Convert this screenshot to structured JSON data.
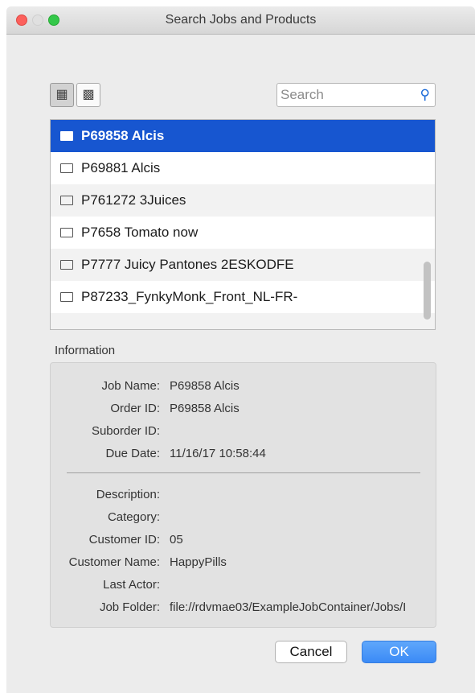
{
  "window": {
    "title": "Search Jobs and Products"
  },
  "toolbar": {
    "view_large_icon": "grid-large-icon",
    "view_small_icon": "grid-small-icon"
  },
  "search": {
    "placeholder": "Search",
    "icon": "magnifier-icon",
    "accent": "#1a6ad8"
  },
  "list": {
    "items": [
      {
        "label": "P69858 Alcis",
        "selected": true
      },
      {
        "label": "P69881 Alcis"
      },
      {
        "label": "P761272 3Juices"
      },
      {
        "label": "P7658 Tomato now"
      },
      {
        "label": "P7777 Juicy Pantones 2ESKODFE"
      },
      {
        "label": "P87233_FynkyMonk_Front_NL-FR-"
      }
    ],
    "selected_color": "#1756d0"
  },
  "information": {
    "title": "Information",
    "fields": [
      {
        "label": "Job Name:",
        "value": "P69858 Alcis"
      },
      {
        "label": "Order ID:",
        "value": "P69858 Alcis"
      },
      {
        "label": "Suborder ID:",
        "value": ""
      },
      {
        "label": "Due Date:",
        "value": "11/16/17 10:58:44"
      },
      {
        "label": "Description:",
        "value": ""
      },
      {
        "label": "Category:",
        "value": ""
      },
      {
        "label": "Customer ID:",
        "value": "05"
      },
      {
        "label": "Customer Name:",
        "value": "HappyPills"
      },
      {
        "label": "Last Actor:",
        "value": ""
      },
      {
        "label": "Job Folder:",
        "value": "file://rdvmae03/ExampleJobContainer/Jobs/I"
      }
    ]
  },
  "buttons": {
    "cancel": "Cancel",
    "ok": "OK",
    "ok_color": "#3b8af6"
  }
}
